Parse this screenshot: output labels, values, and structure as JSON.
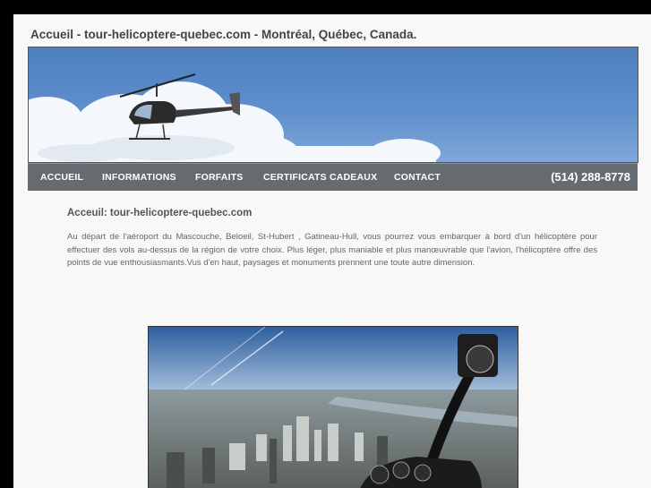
{
  "page": {
    "title": "Accueil - tour-helicoptere-quebec.com - Montréal, Québec, Canada."
  },
  "nav": {
    "items": [
      {
        "label": "ACCUEIL"
      },
      {
        "label": "INFORMATIONS"
      },
      {
        "label": "FORFAITS"
      },
      {
        "label": "CERTIFICATS CADEAUX"
      },
      {
        "label": "CONTACT"
      }
    ],
    "phone": "(514) 288-8778"
  },
  "content": {
    "heading": "Acceuil: tour-helicoptere-quebec.com",
    "paragraph": "Au départ de l'aéroport du Mascouche, Beloeil, St-Hubert , Gatineau-Hull, vous pourrez vous embarquer à bord d'un hélicoptère pour effectuer des vols au-dessus de la région de votre choix. Plus léger, plus maniable et plus manœuvrable que l'avion, l'hélicoptère offre des points de vue enthousiasmants.Vus d'en haut, paysages et monuments prennent une toute autre dimension."
  },
  "colors": {
    "page_background": "#000000",
    "content_background": "#f8f8f8",
    "navbar": "#666b70",
    "sky": "#5b8bc8",
    "text": "#666666"
  },
  "icons": {
    "banner": "helicopter-in-sky-illustration",
    "photo": "aerial-city-view-from-cockpit"
  }
}
